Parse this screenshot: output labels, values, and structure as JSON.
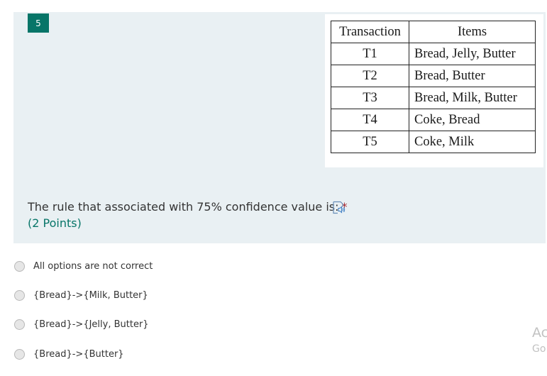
{
  "question": {
    "number": "5",
    "text": "The rule that associated with 75% confidence value is:",
    "required_mark": "*",
    "points": "(2 Points)",
    "colors": {
      "accent": "#077568",
      "card_bg": "#e9f0f3",
      "required": "#a4262c"
    },
    "table": {
      "headers": [
        "Transaction",
        "Items"
      ],
      "rows": [
        [
          "T1",
          "Bread, Jelly, Butter"
        ],
        [
          "T2",
          "Bread, Butter"
        ],
        [
          "T3",
          "Bread, Milk, Butter"
        ],
        [
          "T4",
          "Coke, Bread"
        ],
        [
          "T5",
          "Coke, Milk"
        ]
      ]
    }
  },
  "options": [
    {
      "label": "All options are not correct"
    },
    {
      "label": "{Bread}->{Milk, Butter}"
    },
    {
      "label": "{Bread}->{Jelly, Butter}"
    },
    {
      "label": "{Bread}->{Butter}"
    }
  ],
  "watermark": {
    "line1": "Ac",
    "line2": "Go"
  },
  "icons": {
    "read_aloud": "immersive-reader-speaker-icon"
  }
}
